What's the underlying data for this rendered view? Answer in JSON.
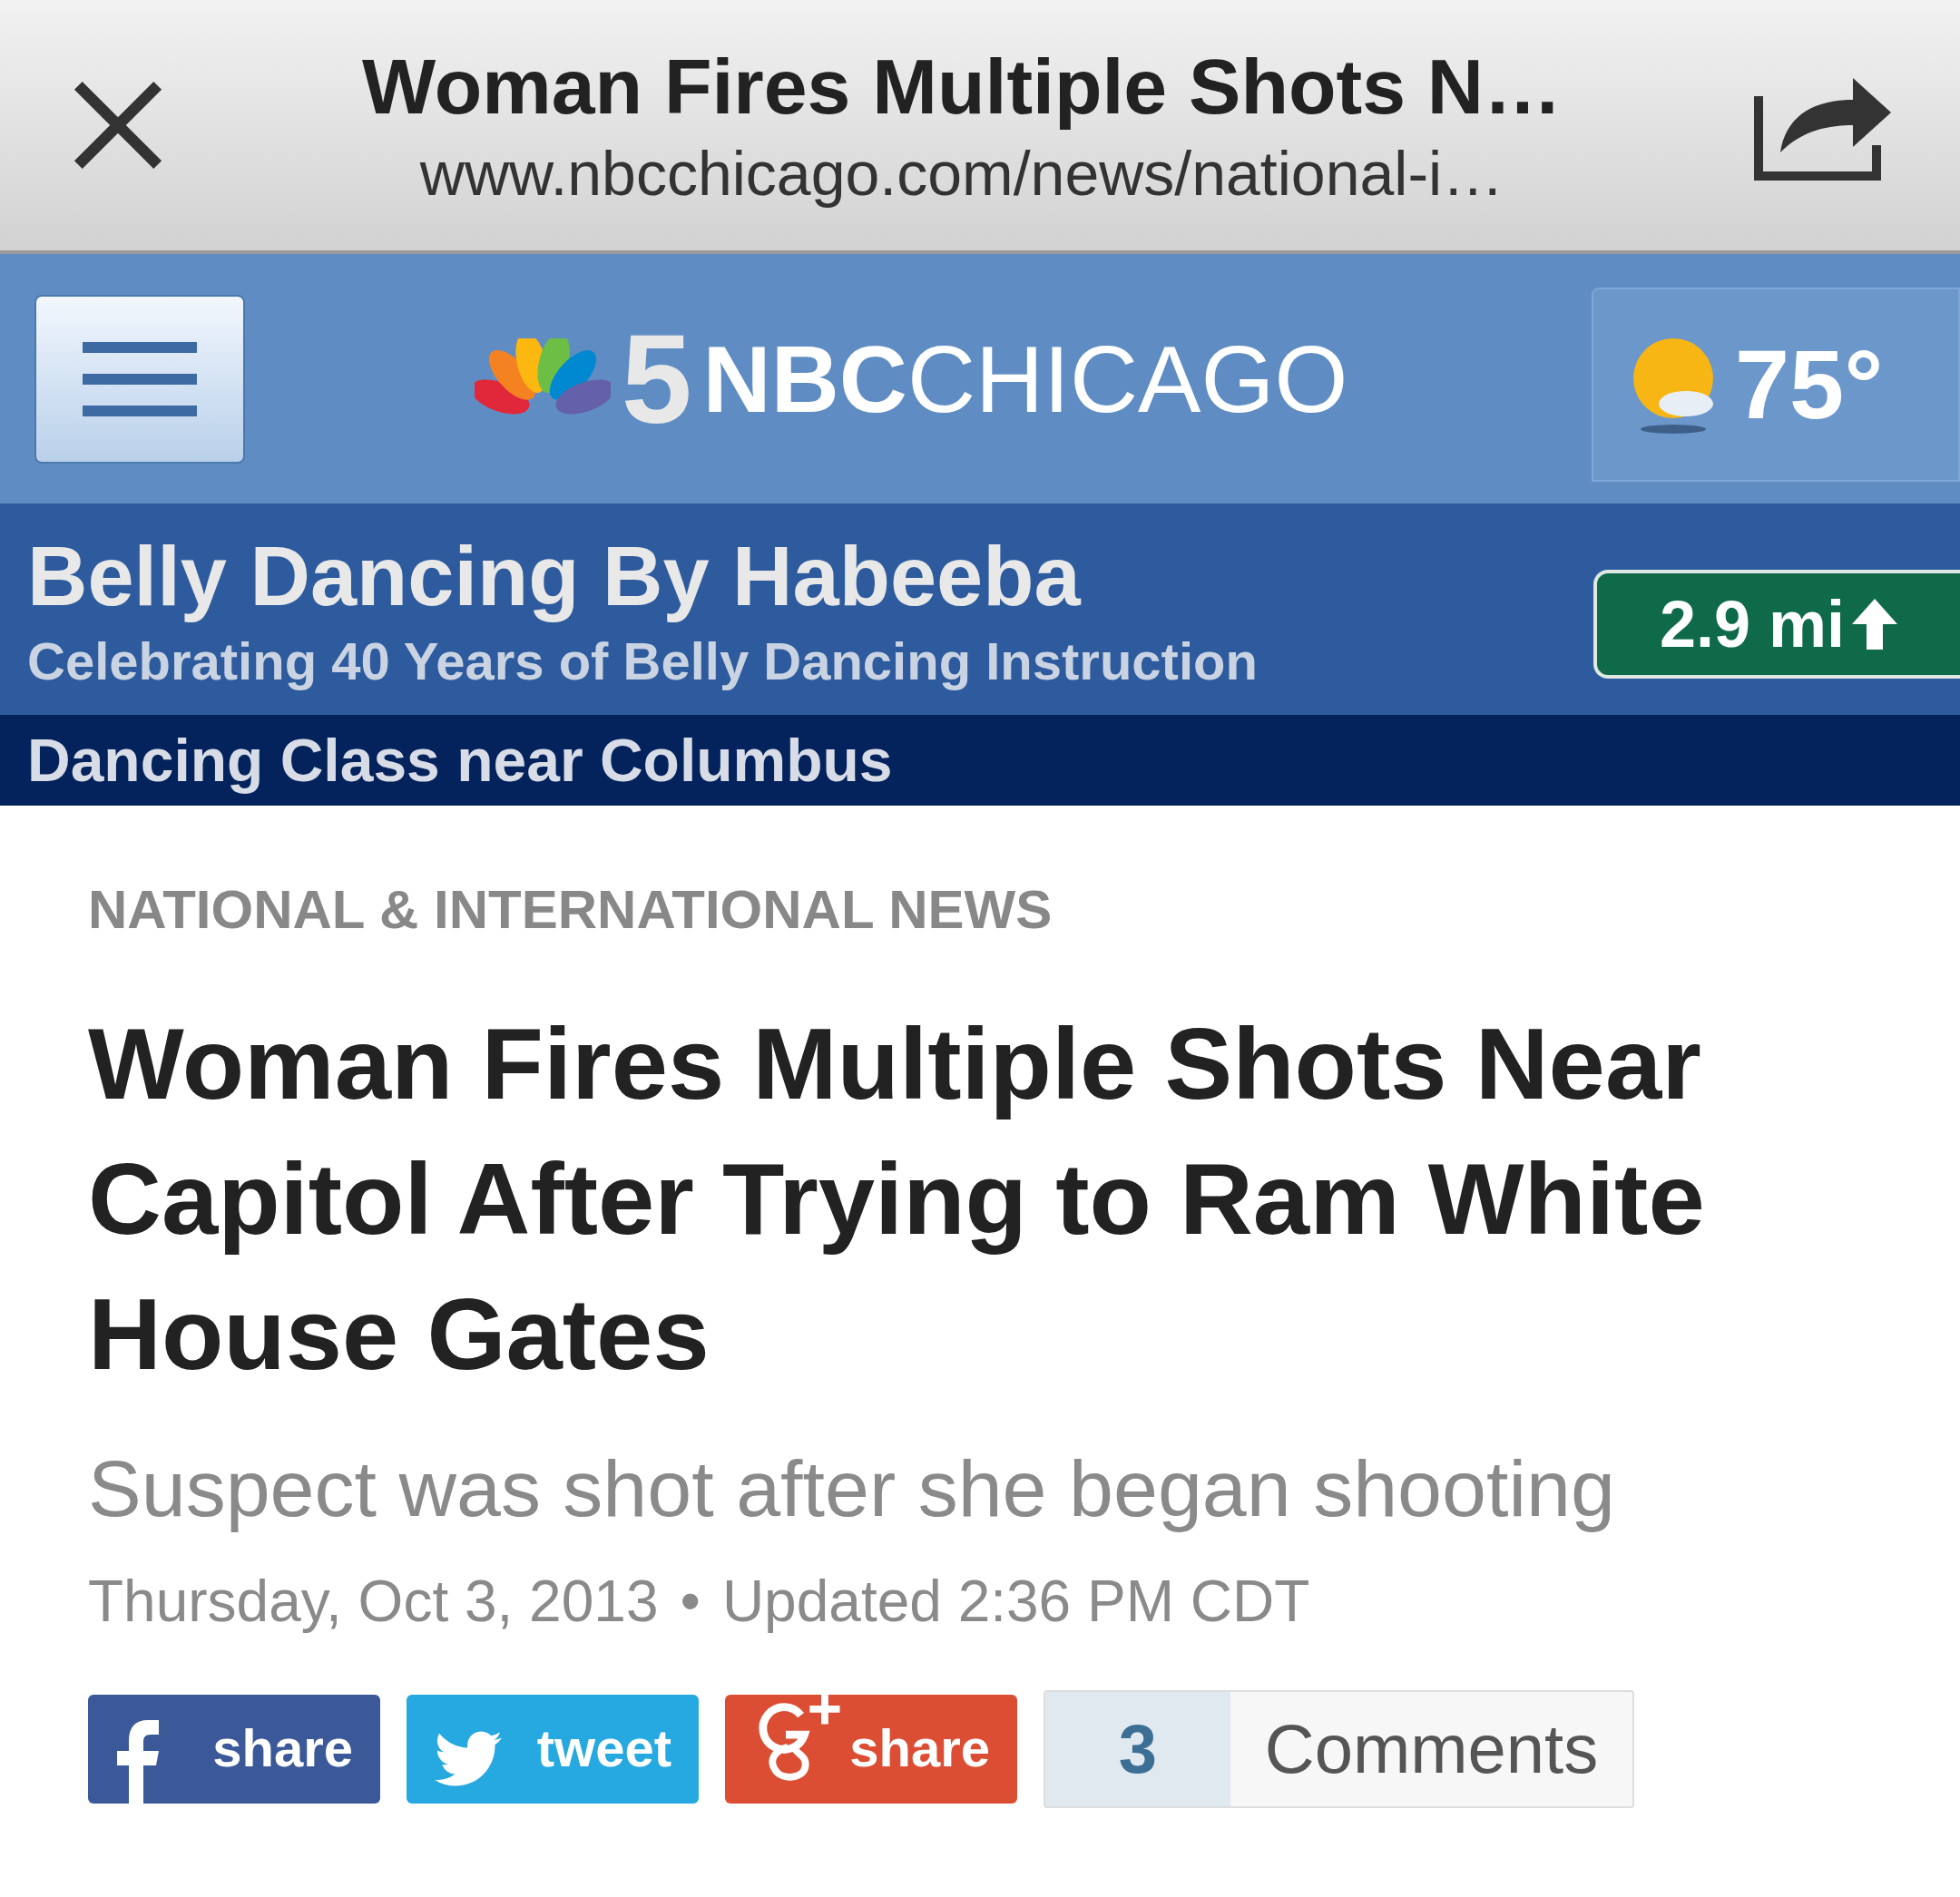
{
  "browser_bar": {
    "title": "Woman Fires Multiple Shots N…",
    "url": "www.nbcchicago.com/news/national-i…"
  },
  "header": {
    "logo_number": "5",
    "logo_bold": "NBC",
    "logo_light": "CHICAGO",
    "temperature": "75°"
  },
  "ad": {
    "title": "Belly Dancing By Habeeba",
    "subtitle": "Celebrating 40 Years of Belly Dancing Instruction",
    "distance": "2.9 mi",
    "footer": "Dancing Class near Columbus"
  },
  "article": {
    "category": "NATIONAL & INTERNATIONAL NEWS",
    "headline": "Woman Fires Multiple Shots Near Capitol After Trying to Ram White House Gates",
    "subtitle": "Suspect was shot after she began shooting",
    "date": "Thursday, Oct 3, 2013",
    "separator": "•",
    "updated": "Updated 2:36 PM CDT"
  },
  "share_buttons": [
    {
      "kind": "facebook",
      "label": "share"
    },
    {
      "kind": "twitter",
      "label": "tweet"
    },
    {
      "kind": "googleplus",
      "label": "share"
    }
  ],
  "comments": {
    "count": "3",
    "label": "Comments"
  }
}
